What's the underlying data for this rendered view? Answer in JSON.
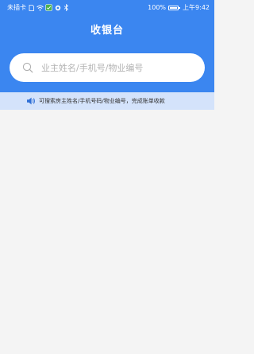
{
  "status_bar": {
    "carrier": "未插卡",
    "battery_percent": "100%",
    "time": "上午9:42",
    "icons": [
      "sim-icon",
      "wifi-icon",
      "app-notification-icon",
      "dot-icon",
      "bluetooth-icon",
      "battery-icon"
    ]
  },
  "header": {
    "title": "收银台"
  },
  "search": {
    "placeholder": "业主姓名/手机号/物业编号",
    "value": ""
  },
  "notice": {
    "icon": "speaker-icon",
    "text": "可搜索房主姓名/手机号码/物业编号，完成账单收款"
  },
  "colors": {
    "primary": "#3b86f0",
    "notice_bg": "#d4e3fb",
    "page_bg": "#f4f4f4"
  }
}
